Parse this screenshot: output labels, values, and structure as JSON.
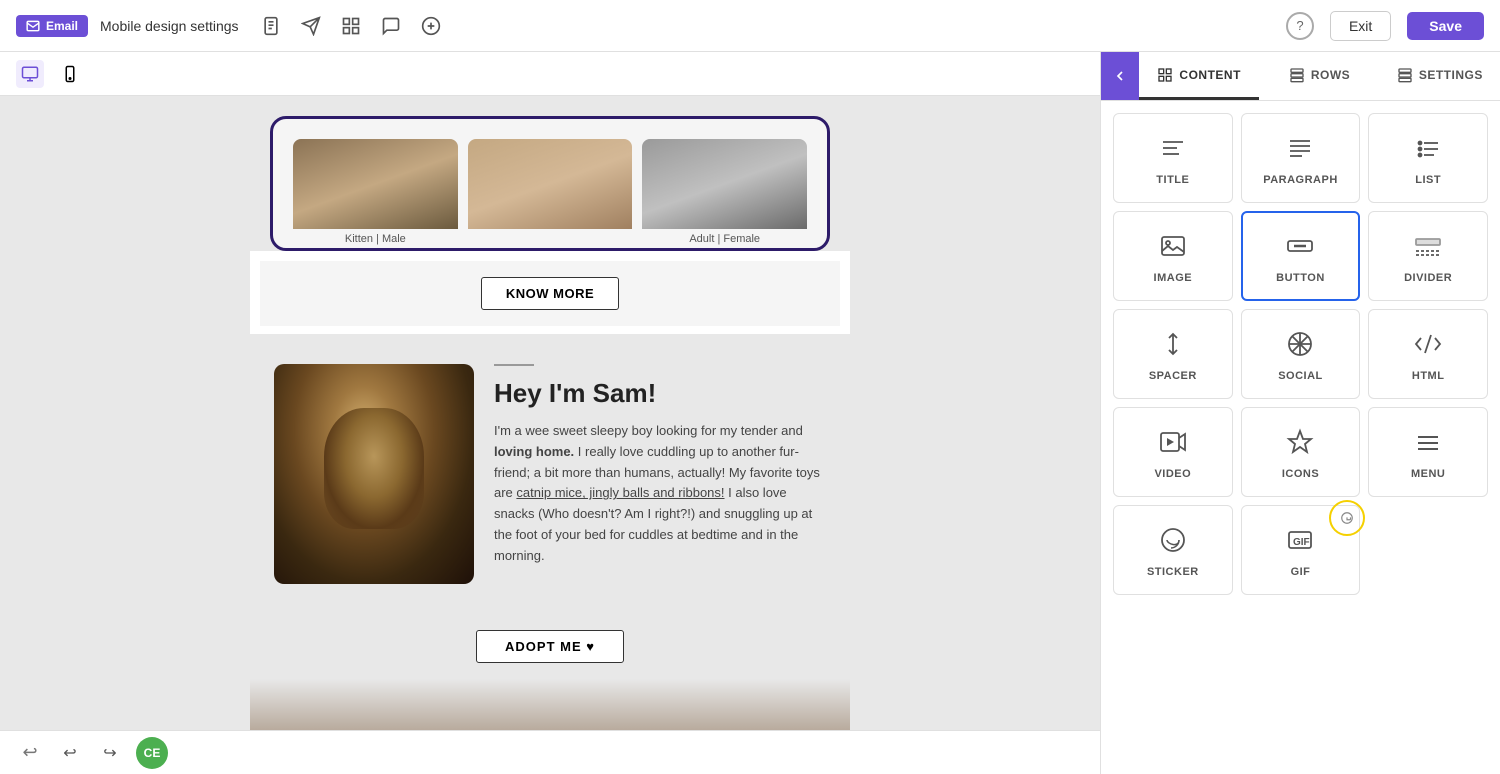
{
  "topbar": {
    "email_badge": "Email",
    "title": "Mobile design settings",
    "exit_label": "Exit",
    "save_label": "Save",
    "help_label": "?"
  },
  "icons": {
    "envelope": "✉",
    "document": "📄",
    "send": "➤",
    "grid": "⊞",
    "chat": "💬",
    "plus_circle": "⊕",
    "desktop": "🖥",
    "mobile": "📱"
  },
  "canvas": {
    "cats": [
      {
        "label": "Kitten | Male"
      },
      {
        "label": ""
      },
      {
        "label": "Adult | Female"
      }
    ],
    "know_more_btn": "KNOW MORE",
    "sam_divider": "",
    "sam_title": "Hey I'm Sam!",
    "sam_body_1": "I'm a wee sweet sleepy boy looking for my tender and ",
    "sam_bold": "loving home.",
    "sam_body_2": " I really love cuddling up to another fur-friend; a bit more than humans, actually! My favorite toys are ",
    "sam_link": "catnip mice, jingly balls and ribbons!",
    "sam_body_3": " I also love snacks (Who doesn't? Am I right?!) and snuggling up at the foot of your bed for cuddles at bedtime and in the morning.",
    "adopt_btn": "ADOPT ME ♥"
  },
  "panel": {
    "tabs": [
      {
        "label": "CONTENT",
        "active": true
      },
      {
        "label": "ROWS",
        "active": false
      },
      {
        "label": "SETTINGS",
        "active": false
      }
    ],
    "content_items": [
      {
        "id": "title",
        "label": "TITLE"
      },
      {
        "id": "paragraph",
        "label": "PARAGRAPH"
      },
      {
        "id": "list",
        "label": "LIST"
      },
      {
        "id": "image",
        "label": "IMAGE"
      },
      {
        "id": "button",
        "label": "BUTTON"
      },
      {
        "id": "divider",
        "label": "DIVIDER"
      },
      {
        "id": "spacer",
        "label": "SPACER"
      },
      {
        "id": "social",
        "label": "SOCIAL"
      },
      {
        "id": "html",
        "label": "HTML"
      },
      {
        "id": "video",
        "label": "VIDEO"
      },
      {
        "id": "icons",
        "label": "ICONS"
      },
      {
        "id": "menu",
        "label": "MENU"
      },
      {
        "id": "sticker",
        "label": "STICKER"
      },
      {
        "id": "gif",
        "label": "GIF"
      }
    ]
  },
  "bottombar": {
    "avatar": "CE"
  }
}
